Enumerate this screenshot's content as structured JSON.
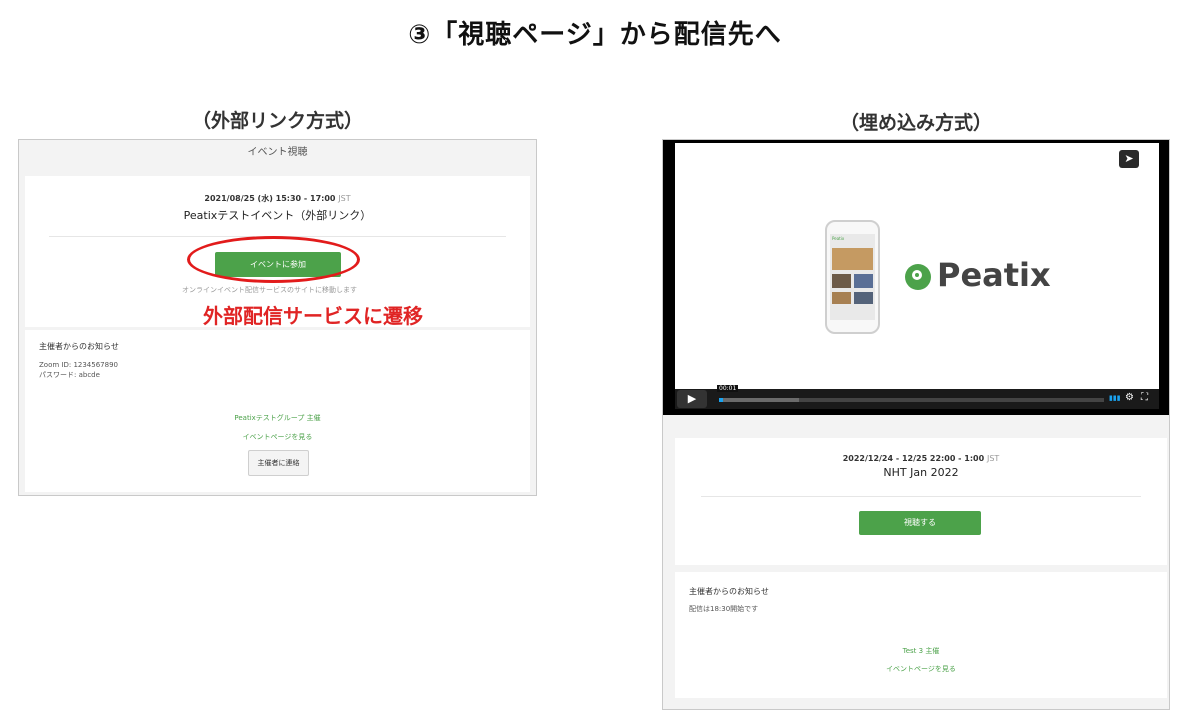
{
  "page_title": "③「視聴ページ」から配信先へ",
  "left": {
    "subtitle": "（外部リンク方式）",
    "header": "イベント視聴",
    "date": "2021/08/25 (水) 15:30 - 17:00",
    "tz": "JST",
    "event_name": "Peatixテストイベント（外部リンク）",
    "join_button": "イベントに参加",
    "helper_text": "オンラインイベント配信サービスのサイトに移動します",
    "annotation": "外部配信サービスに遷移",
    "notice_heading": "主催者からのお知らせ",
    "notice_lines": [
      "Zoom ID: 1234567890",
      "パスワード: abcde"
    ],
    "organizer": "Peatixテストグループ  主催",
    "event_page_link": "イベントページを見る",
    "contact_button": "主催者に連絡"
  },
  "right": {
    "subtitle": "（埋め込み方式）",
    "logo_text": "Peatix",
    "phone_header": "Peatix",
    "time_label": "00:01",
    "progress": 0.01,
    "date": "2022/12/24 - 12/25 22:00 - 1:00",
    "tz": "JST",
    "event_name": "NHT Jan 2022",
    "watch_button": "視聴する",
    "notice_heading": "主催者からのお知らせ",
    "notice_text": "配信は18:30開始です",
    "organizer": "Test 3 主催",
    "event_page_link": "イベントページを見る"
  },
  "colors": {
    "accent_green": "#4ca24a",
    "annotation_red": "#e02424",
    "player_progress": "#1aa3f0"
  },
  "icons": [
    "share-icon",
    "play-icon",
    "volume-icon",
    "gear-icon",
    "fullscreen-icon",
    "peatix-logo-icon"
  ]
}
